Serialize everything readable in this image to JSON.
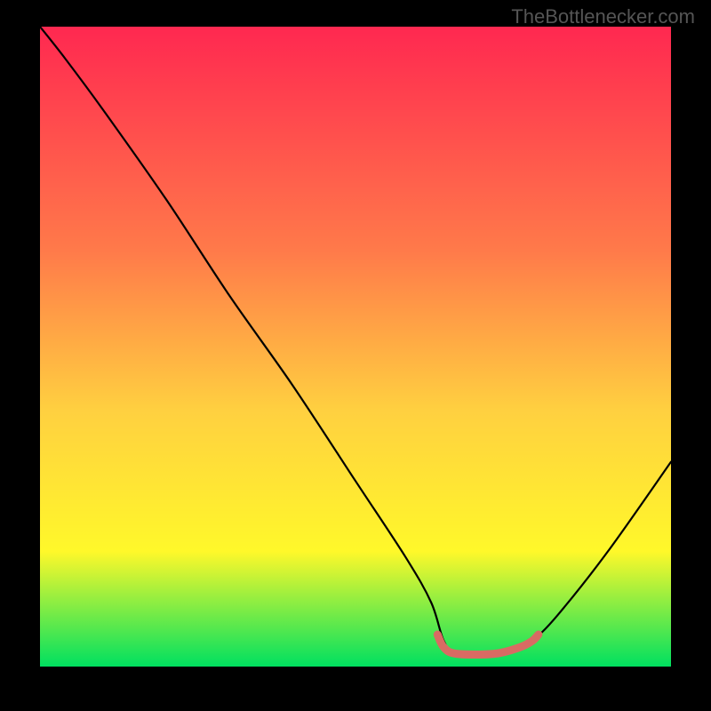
{
  "watermark": "TheBottlenecker.com",
  "chart_data": {
    "type": "line",
    "title": "",
    "xlabel": "",
    "ylabel": "",
    "xlim": [
      0,
      100
    ],
    "ylim": [
      0,
      100
    ],
    "series": [
      {
        "name": "curve",
        "x": [
          0,
          4,
          10,
          20,
          30,
          40,
          50,
          58,
          62,
          64,
          66,
          72,
          76,
          78,
          82,
          90,
          100
        ],
        "values": [
          100,
          95,
          87,
          73,
          58,
          44,
          29,
          17,
          10,
          4,
          2,
          2,
          3,
          4,
          8,
          18,
          32
        ]
      },
      {
        "name": "highlight",
        "x": [
          63,
          64,
          66,
          72,
          76,
          78,
          79
        ],
        "values": [
          5,
          3,
          2,
          2,
          3,
          4,
          5
        ]
      }
    ],
    "colors": {
      "curve": "#000000",
      "highlight": "#d86b63",
      "gradient_top": "#ff2850",
      "gradient_mid1": "#ff7a4a",
      "gradient_mid2": "#ffd040",
      "gradient_mid3": "#fff82a",
      "gradient_bottom": "#00e060"
    }
  }
}
